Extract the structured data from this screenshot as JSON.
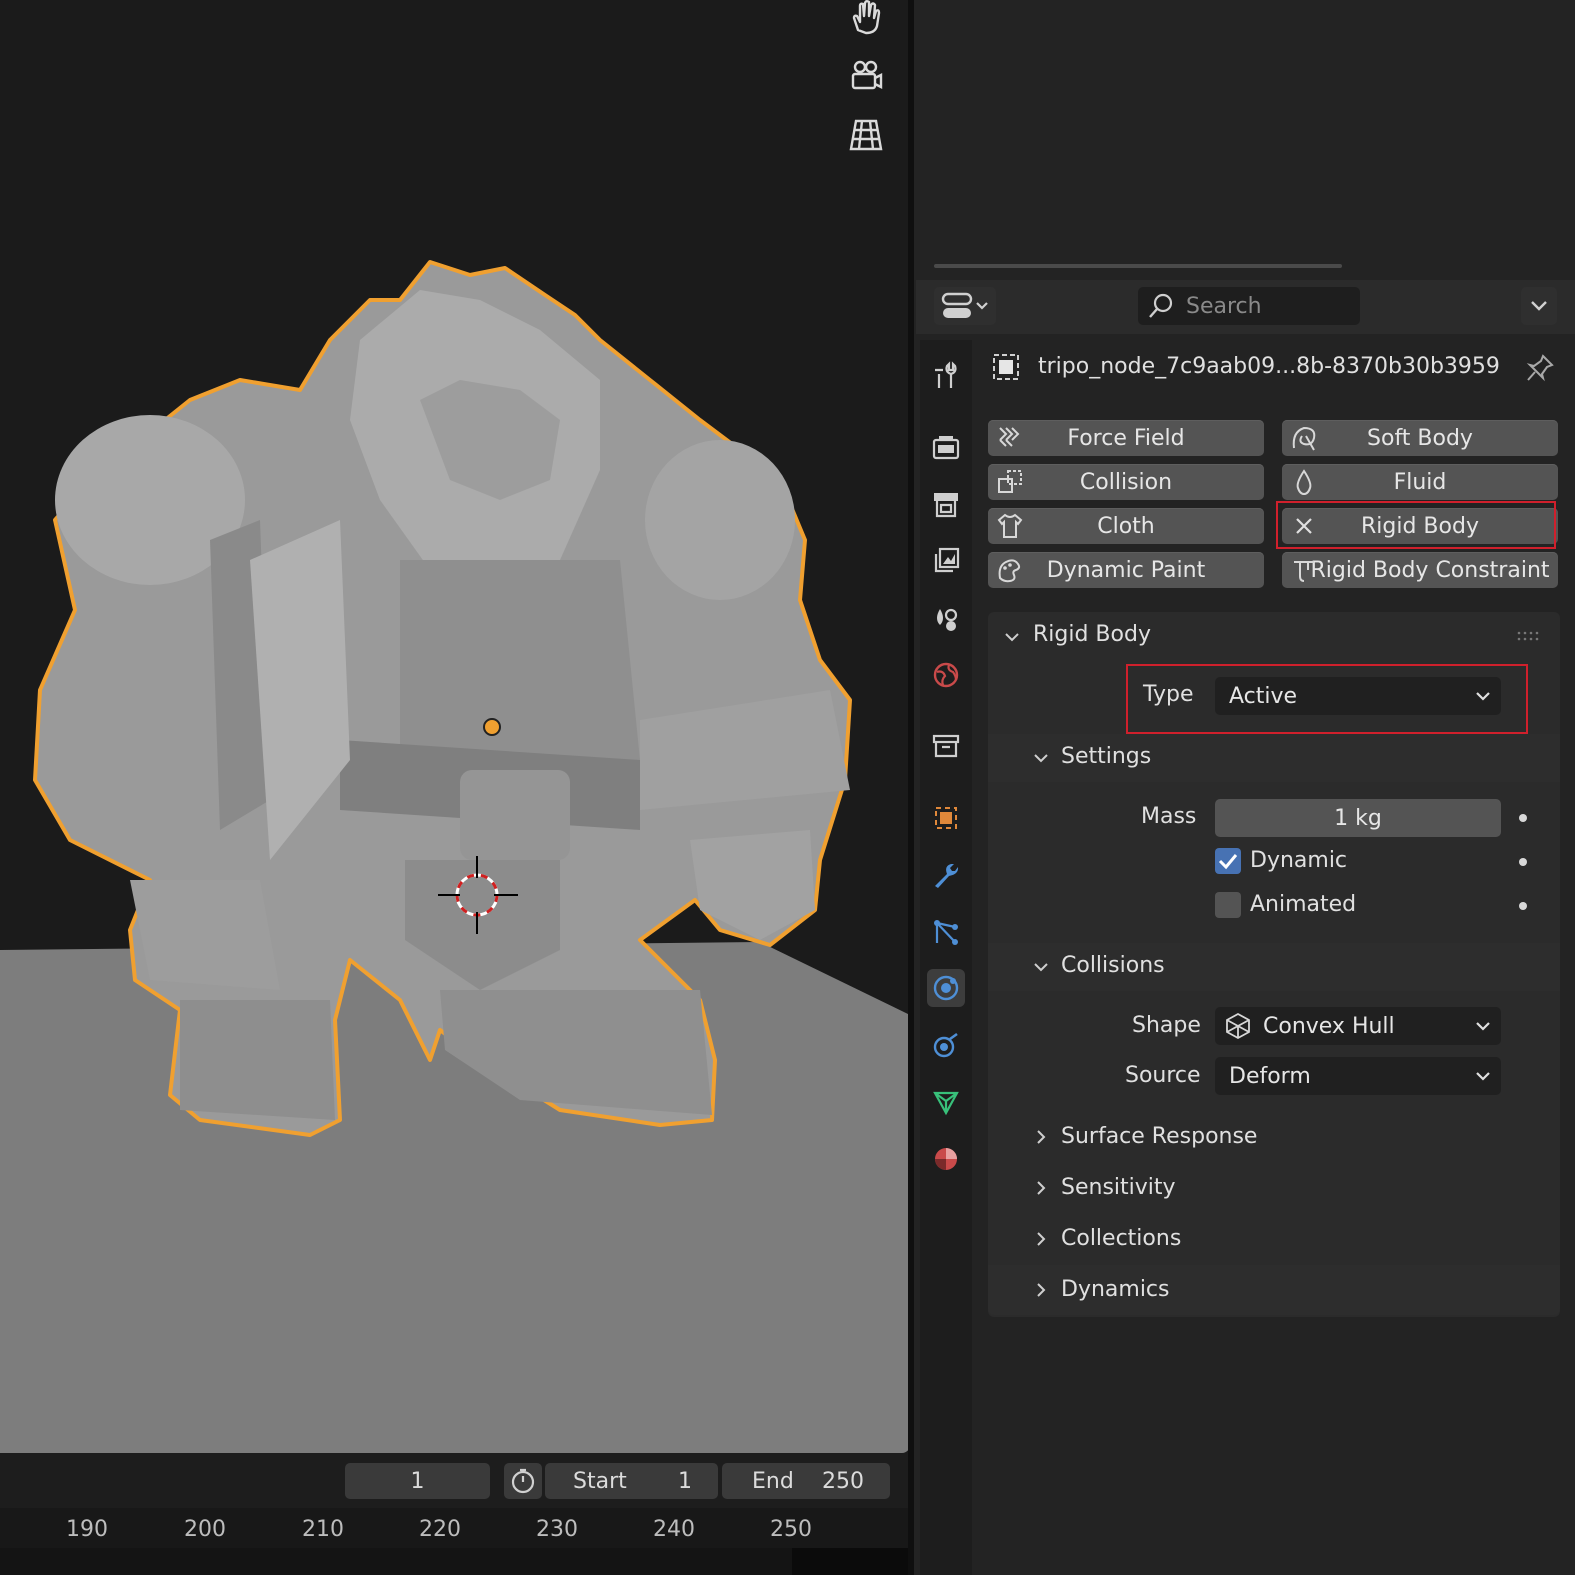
{
  "object": {
    "name": "tripo_node_7c9aab09...8b-8370b30b3959"
  },
  "header": {
    "search_placeholder": "Search"
  },
  "physics_buttons": [
    {
      "label": "Force Field",
      "icon": "force-field-icon"
    },
    {
      "label": "Soft Body",
      "icon": "soft-body-icon"
    },
    {
      "label": "Collision",
      "icon": "collision-icon"
    },
    {
      "label": "Fluid",
      "icon": "fluid-icon"
    },
    {
      "label": "Cloth",
      "icon": "cloth-icon"
    },
    {
      "label": "Rigid Body",
      "icon": "close-icon",
      "enabled": true
    },
    {
      "label": "Dynamic Paint",
      "icon": "dynamic-paint-icon"
    },
    {
      "label": "Rigid Body Constraint",
      "icon": "rigid-body-constraint-icon"
    }
  ],
  "rigid_body": {
    "title": "Rigid Body",
    "type_label": "Type",
    "type_value": "Active",
    "settings": {
      "title": "Settings",
      "mass_label": "Mass",
      "mass_value": "1 kg",
      "dynamic_label": "Dynamic",
      "dynamic_checked": true,
      "animated_label": "Animated",
      "animated_checked": false
    },
    "collisions": {
      "title": "Collisions",
      "shape_label": "Shape",
      "shape_value": "Convex Hull",
      "source_label": "Source",
      "source_value": "Deform"
    },
    "collapsed_sections": [
      "Surface Response",
      "Sensitivity",
      "Collections",
      "Dynamics"
    ]
  },
  "timeline": {
    "current_frame": "1",
    "start_label": "Start",
    "start_value": "1",
    "end_label": "End",
    "end_value": "250",
    "ruler_ticks": [
      "190",
      "200",
      "210",
      "220",
      "230",
      "240",
      "250"
    ]
  },
  "colors": {
    "selection_outline": "#f0a030",
    "highlight_box": "#d0202c",
    "checkbox_blue": "#4772b3"
  }
}
